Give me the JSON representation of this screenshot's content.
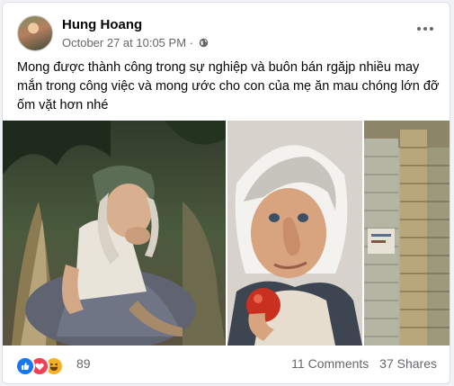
{
  "post": {
    "author": "Hung Hoang",
    "timestamp": "October 27 at 10:05 PM",
    "separator": "·",
    "privacy_icon": "globe-icon",
    "more_icon": "more-horizontal-icon",
    "text": "Mong được thành công trong sự nghiệp và buôn bán rgăjp nhiều may mắn trong công việc  và mong ước cho con của mẹ ăn mau chóng lớn đỡ ốm vặt hơn nhé"
  },
  "reactions": {
    "icons": [
      "like-icon",
      "love-icon",
      "haha-icon"
    ],
    "count": "89",
    "comments": "11 Comments",
    "shares": "37 Shares",
    "colors": {
      "like": "#1877f2",
      "love": "#f33e58",
      "haha": "#f7b125"
    }
  }
}
